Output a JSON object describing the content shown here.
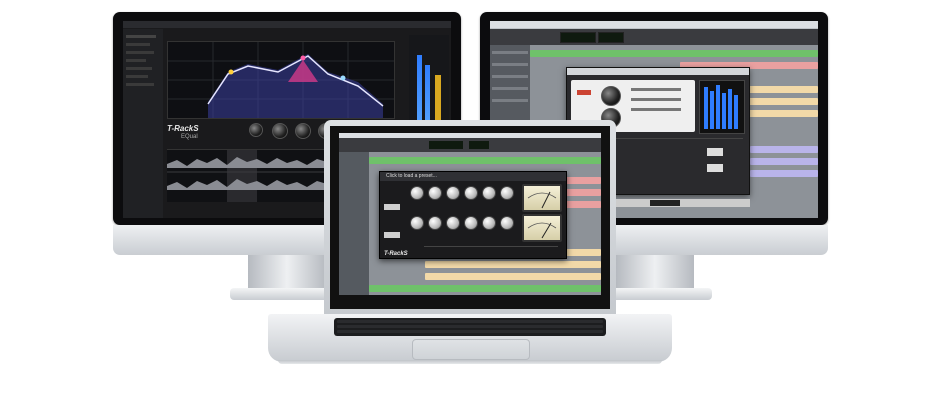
{
  "left_monitor": {
    "brand_logo": "T-RackS",
    "brand_sublabel": "EQual"
  },
  "laptop": {
    "preset_prompt": "Click to load a preset...",
    "plugin_logo": "T-RackS"
  },
  "colors": {
    "eq_accent": "#b089ff",
    "meter_blue": "#2f7dff",
    "clip_green": "#6fc16a",
    "clip_peach": "#f2d9a8",
    "clip_pink": "#e9a0a0",
    "clip_lavender": "#b9b4ea"
  }
}
